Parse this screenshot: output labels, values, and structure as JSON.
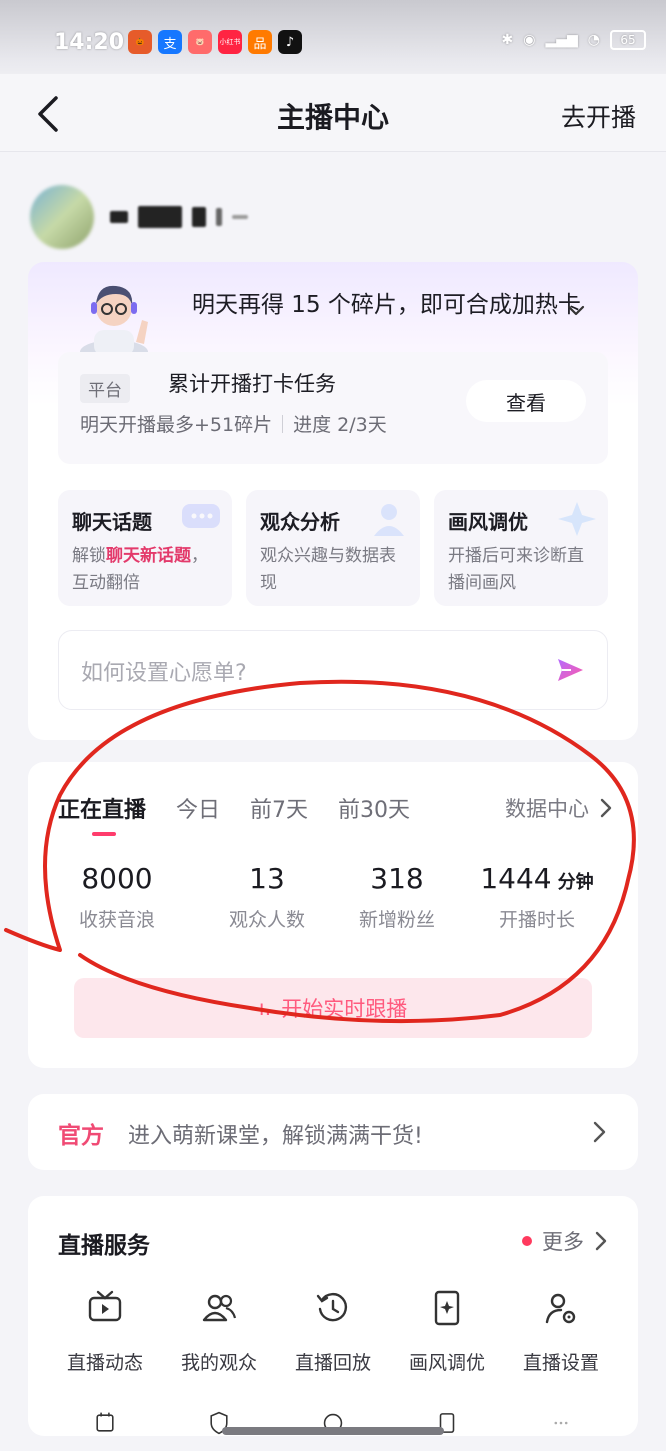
{
  "status_bar": {
    "time": "14:20",
    "apps": [
      {
        "icon": "pumpkin-app-icon",
        "color": "#e65b2a",
        "glyph": "🎃"
      },
      {
        "icon": "alipay-app-icon",
        "color": "#1677ff",
        "glyph": "支"
      },
      {
        "icon": "game-app-icon",
        "color": "#ff6b6b",
        "glyph": "🐷"
      },
      {
        "icon": "xiaohongshu-app-icon",
        "color": "#ff2442",
        "glyph": "小红书"
      },
      {
        "icon": "taobao-app-icon",
        "color": "#ff7a00",
        "glyph": "品"
      },
      {
        "icon": "tiktok-app-icon",
        "color": "#111111",
        "glyph": "♪"
      }
    ],
    "battery": "65"
  },
  "navbar": {
    "title": "主播中心",
    "right_action": "去开播"
  },
  "tip": {
    "text": "明天再得 15 个碎片，即可合成加热卡"
  },
  "task": {
    "tag": "平台",
    "title": "累计开播打卡任务",
    "subtitle_left": "明天开播最多+51碎片",
    "subtitle_right": "进度 2/3天",
    "button": "查看"
  },
  "tools": [
    {
      "title": "聊天话题",
      "desc_pre": "解锁",
      "desc_highlight": "聊天新话题",
      "desc_post": "，互动翻倍"
    },
    {
      "title": "观众分析",
      "desc_pre": "观众兴趣与数据表现",
      "desc_highlight": "",
      "desc_post": ""
    },
    {
      "title": "画风调优",
      "desc_pre": "开播后可来诊断直播间画风",
      "desc_highlight": "",
      "desc_post": ""
    }
  ],
  "ask": {
    "placeholder": "如何设置心愿单?"
  },
  "live": {
    "tabs": [
      "正在直播",
      "今日",
      "前7天",
      "前30天"
    ],
    "active_tab": "正在直播",
    "data_center": "数据中心",
    "stats": [
      {
        "value": "8000",
        "unit": "",
        "label": "收获音浪"
      },
      {
        "value": "13",
        "unit": "",
        "label": "观众人数"
      },
      {
        "value": "318",
        "unit": "",
        "label": "新增粉丝"
      },
      {
        "value": "1444",
        "unit": "分钟",
        "label": "开播时长"
      }
    ],
    "button": "开始实时跟播"
  },
  "official": {
    "tag": "官方",
    "text": "进入萌新课堂，解锁满满干货!"
  },
  "services": {
    "title": "直播服务",
    "more": "更多",
    "items": [
      {
        "label": "直播动态",
        "icon": "tv-icon"
      },
      {
        "label": "我的观众",
        "icon": "audience-icon"
      },
      {
        "label": "直播回放",
        "icon": "replay-icon"
      },
      {
        "label": "画风调优",
        "icon": "style-tune-icon"
      },
      {
        "label": "直播设置",
        "icon": "settings-user-icon"
      }
    ]
  },
  "colors": {
    "accent": "#ff3c6c",
    "annotation": "#e0271e"
  }
}
